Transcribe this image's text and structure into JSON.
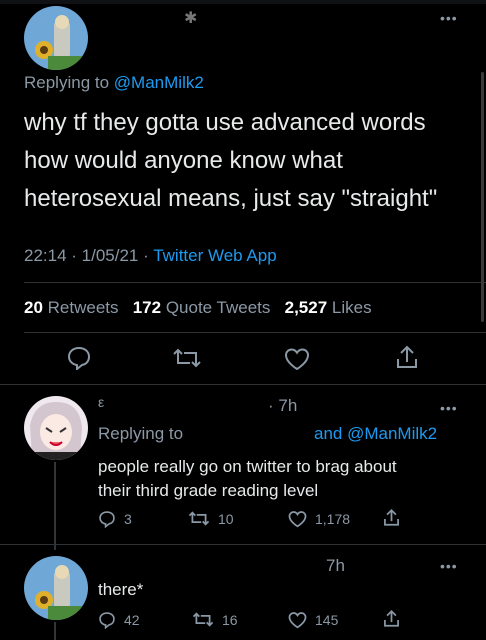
{
  "main_tweet": {
    "avatar_icon": "profile-avatar-sunflower",
    "reply_prefix": "Replying to",
    "reply_handle": "@ManMilk2",
    "text_line1": "why tf they gotta use advanced words",
    "text_line2": "how would anyone know what",
    "text_line3": "heterosexual means, just say \"straight\"",
    "timestamp": "22:14 · 1/05/21 ·",
    "source": "Twitter Web App",
    "retweets_count": "20",
    "retweets_label": "Retweets",
    "quote_count": "172",
    "quote_label": "Quote Tweets",
    "likes_count": "2,527",
    "likes_label": "Likes",
    "more_icon": "more-dots-icon"
  },
  "actions": [
    "reply-icon",
    "retweet-icon",
    "like-icon",
    "share-icon"
  ],
  "reply1": {
    "avatar_icon": "profile-avatar-anime",
    "time": "· 7h",
    "reply_prefix": "Replying to",
    "reply_suffix": "and @ManMilk2",
    "text_line1": "people really go on twitter to brag about",
    "text_line2": "their third grade reading level",
    "reply_count": "3",
    "retweet_count": "10",
    "like_count": "1,178"
  },
  "reply2": {
    "avatar_icon": "profile-avatar-sunflower",
    "time": "7h",
    "text": "there*",
    "reply_count": "42",
    "retweet_count": "16",
    "like_count": "145"
  },
  "colors": {
    "background": "#000000",
    "accent": "#1d9bf0",
    "muted": "#8b98a5",
    "divider": "#2f3336"
  }
}
